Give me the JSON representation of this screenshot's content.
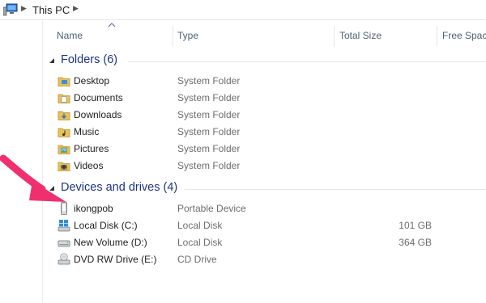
{
  "address": {
    "crumb": "This PC"
  },
  "columns": {
    "name": "Name",
    "type": "Type",
    "total_size": "Total Size",
    "free_space": "Free Space"
  },
  "groups": {
    "folders": {
      "title": "Folders (6)",
      "items": [
        {
          "name": "Desktop",
          "type": "System Folder",
          "icon": "desktop-folder-icon"
        },
        {
          "name": "Documents",
          "type": "System Folder",
          "icon": "documents-folder-icon"
        },
        {
          "name": "Downloads",
          "type": "System Folder",
          "icon": "downloads-folder-icon"
        },
        {
          "name": "Music",
          "type": "System Folder",
          "icon": "music-folder-icon"
        },
        {
          "name": "Pictures",
          "type": "System Folder",
          "icon": "pictures-folder-icon"
        },
        {
          "name": "Videos",
          "type": "System Folder",
          "icon": "videos-folder-icon"
        }
      ]
    },
    "devices": {
      "title": "Devices and drives (4)",
      "items": [
        {
          "name": "ikongpob",
          "type": "Portable Device",
          "size": "",
          "icon": "portable-device-icon"
        },
        {
          "name": "Local Disk (C:)",
          "type": "Local Disk",
          "size": "101 GB",
          "icon": "windows-drive-icon"
        },
        {
          "name": "New Volume (D:)",
          "type": "Local Disk",
          "size": "364 GB",
          "icon": "hard-drive-icon"
        },
        {
          "name": "DVD RW Drive (E:)",
          "type": "CD Drive",
          "size": "",
          "icon": "dvd-drive-icon"
        }
      ]
    }
  },
  "colors": {
    "group_title": "#1e3287",
    "header_text": "#4c607a",
    "annotation_arrow": "#f0306e"
  }
}
